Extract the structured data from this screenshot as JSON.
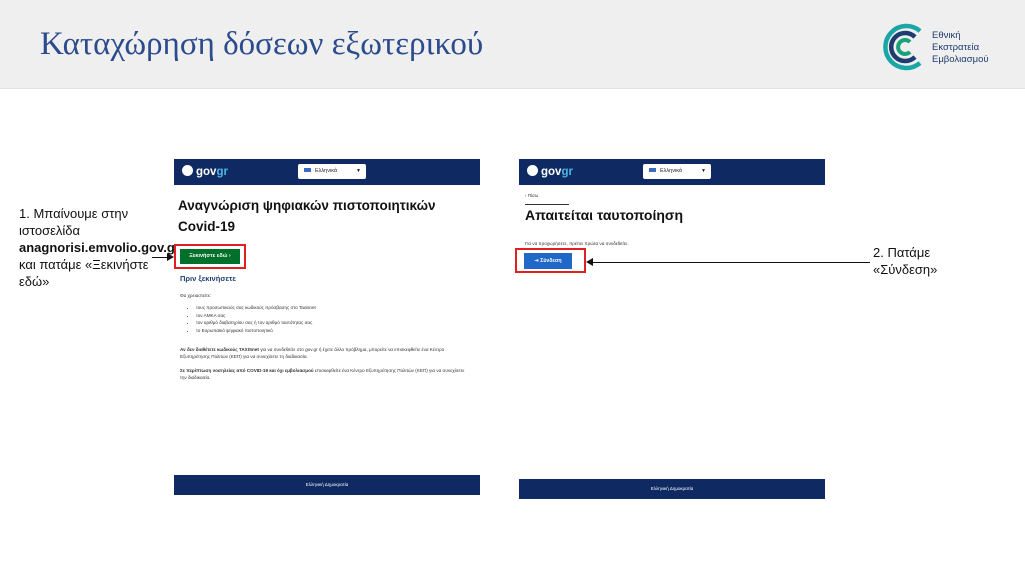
{
  "slide": {
    "title": "Καταχώρηση δόσεων εξωτερικού",
    "logo": {
      "line1": "Εθνική",
      "line2": "Εκστρατεία",
      "line3": "Εμβολιασμού"
    }
  },
  "step1": {
    "line_a": "1. Μπαίνουμε στην ιστοσελίδα",
    "site": "anagnorisi.emvolio.gov.gr",
    "line_b": "και πατάμε «Ξεκινήστε εδώ»"
  },
  "step2": {
    "text": "2. Πατάμε «Σύνδεση»"
  },
  "screenshot1": {
    "brand_main": "gov",
    "brand_suffix": "gr",
    "language": "Ελληνικά",
    "heading": "Αναγνώριση ψηφιακών πιστοποιητικών Covid-19",
    "start_button": "Ξεκινήστε εδώ  ›",
    "before_heading": "Πριν ξεκινήσετε",
    "need_label": "Θα χρειαστείτε:",
    "requirements": [
      "τους προσωπικούς σας κωδικούς πρόσβασης στο Taxisnet",
      "τον ΑΜΚΑ σας",
      "τον αριθμό διαβατηρίου σας ή τον αριθμό ταυτότητας σας",
      "το Ευρωπαϊκό ψηφιακό πιστοποιητικό"
    ],
    "note1_bold": "Αν δεν διαθέτετε κωδικούς TAXISnet",
    "note1_rest": "για να συνδεθείτε στο gov.gr ή έχετε άλλο πρόβλημα, μπορείτε να επισκεφθείτε ένα Κέντρο Εξυπηρέτησης Πολιτών (ΚΕΠ) για να συνεχίσετε τη διαδικασία.",
    "note2_bold": "Σε περίπτωση νοσηλείας από COVID-19 και όχι εμβολιασμού",
    "note2_rest": "επισκεφθείτε ένα Κέντρο Εξυπηρέτησης Πολιτών (ΚΕΠ) για να συνεχίσετε την διαδικασία.",
    "footer": "Ελληνική Δημοκρατία"
  },
  "screenshot2": {
    "brand_main": "gov",
    "brand_suffix": "gr",
    "language": "Ελληνικά",
    "back": "‹ Πίσω",
    "heading": "Απαιτείται ταυτοποίηση",
    "instruction": "Για να προχωρήσετε, πρέπει πρώτα να συνδεθείτε.",
    "login_button": "⇥ Σύνδεση",
    "footer": "Ελληνική Δημοκρατία"
  }
}
